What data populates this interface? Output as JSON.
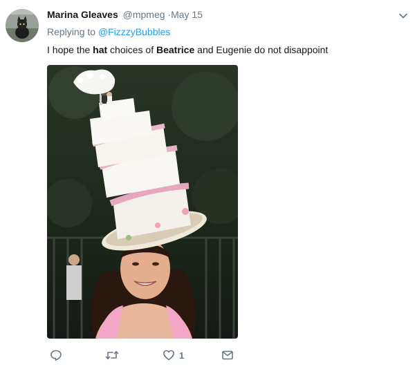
{
  "tweet": {
    "display_name": "Marina Gleaves",
    "handle": "@mpmeg",
    "separator": "·",
    "date": "May 15",
    "replying_prefix": "Replying to",
    "replying_to": "@FizzzyBubbles",
    "text_parts": [
      "I hope the ",
      "hat",
      " choices of ",
      "Beatrice",
      " and Eugenie do not disappoint"
    ],
    "like_count": "1"
  },
  "icons": {
    "caret": "chevron-down-icon",
    "reply": "reply-icon",
    "retweet": "retweet-icon",
    "like": "heart-icon",
    "dm": "envelope-icon"
  },
  "colors": {
    "link": "#1da1f2",
    "secondary_text": "#657786",
    "primary_text": "#14171a"
  }
}
